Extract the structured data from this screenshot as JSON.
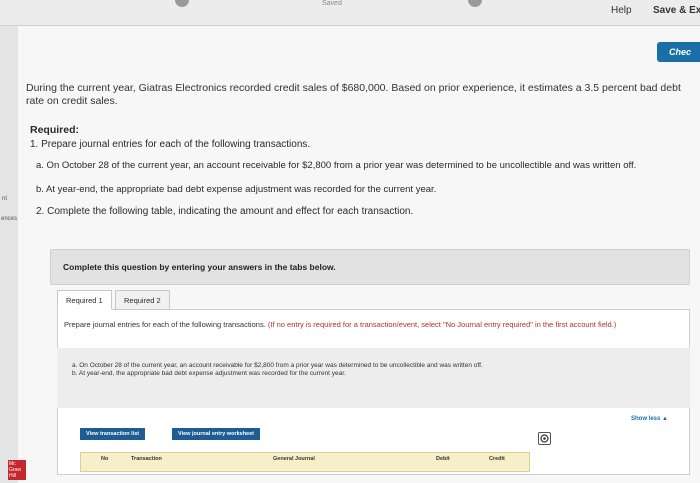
{
  "topbar": {
    "saved_label": "Saved",
    "help_label": "Help",
    "save_exit_label": "Save & Ex"
  },
  "check_label": "Chec",
  "sidebar": {
    "labels": [
      "nt",
      "ences"
    ]
  },
  "logo_text": "Mc Graw Hill",
  "problem": {
    "intro": "During the current year, Giatras Electronics recorded credit sales of $680,000. Based on prior experience, it estimates a 3.5 percent bad debt rate on credit sales.",
    "required_title": "Required:",
    "required_1": "1. Prepare journal entries for each of the following transactions.",
    "tx_a": "a. On October 28 of the current year, an account receivable for $2,800 from a prior year was determined to be uncollectible and was written off.",
    "tx_b": "b. At year-end, the appropriate bad debt expense adjustment was recorded for the current year.",
    "required_2": "2. Complete the following table, indicating the amount and effect for each transaction."
  },
  "question_box": {
    "text": "Complete this question by entering your answers in the tabs below."
  },
  "tabs": [
    "Required 1",
    "Required 2"
  ],
  "panel": {
    "instruction_main": "Prepare journal entries for each of the following transactions.",
    "instruction_red": "(If no entry is required for a transaction/event, select \"No Journal entry required\" in the first account field.)",
    "tx_a": "a. On October 28 of the current year, an account receivable for $2,800 from a prior year was determined to be uncollectible and was written off.",
    "tx_b": "b. At year-end, the appropriate bad debt expense adjustment was recorded for the current year.",
    "show_less": "Show less ▲",
    "view_transaction_list": "View transaction list",
    "view_journal_worksheet": "View journal entry worksheet"
  },
  "grid": {
    "columns": [
      "No",
      "Transaction",
      "General Journal",
      "Debit",
      "Credit"
    ]
  }
}
